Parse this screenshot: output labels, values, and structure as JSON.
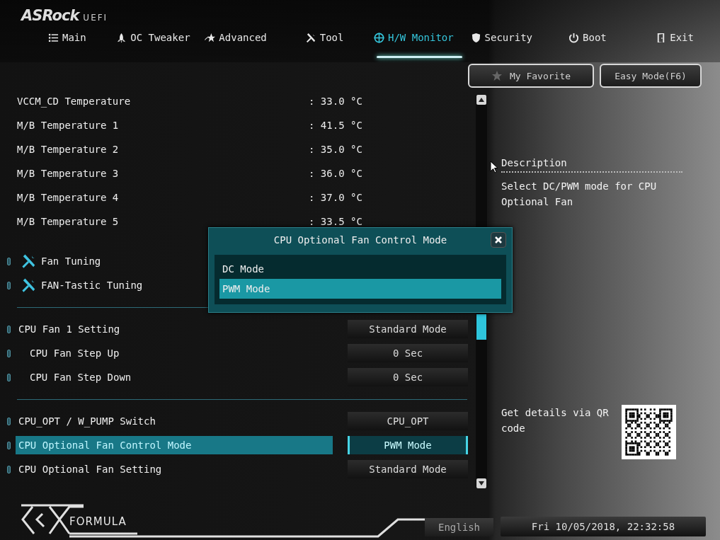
{
  "logo": {
    "brand": "ASRock",
    "suffix": "UEFI"
  },
  "tabs": [
    {
      "label": "Main",
      "kind": "list",
      "selected": false
    },
    {
      "label": "OC Tweaker",
      "kind": "rocket",
      "selected": false
    },
    {
      "label": "Advanced",
      "kind": "star",
      "selected": false
    },
    {
      "label": "Tool",
      "kind": "tools",
      "selected": false
    },
    {
      "label": "H/W Monitor",
      "kind": "crosshair",
      "selected": true
    },
    {
      "label": "Security",
      "kind": "shield",
      "selected": false
    },
    {
      "label": "Boot",
      "kind": "power",
      "selected": false
    },
    {
      "label": "Exit",
      "kind": "door",
      "selected": false
    }
  ],
  "toolbar": {
    "favorite": "My Favorite",
    "easy_mode": "Easy Mode(F6)"
  },
  "items": [
    {
      "kind": "reading",
      "label": "VCCM_CD Temperature",
      "value": ": 33.0 °C"
    },
    {
      "kind": "reading",
      "label": "M/B Temperature 1",
      "value": ": 41.5 °C"
    },
    {
      "kind": "reading",
      "label": "M/B Temperature 2",
      "value": ": 35.0 °C"
    },
    {
      "kind": "reading",
      "label": "M/B Temperature 3",
      "value": ": 36.0 °C"
    },
    {
      "kind": "reading",
      "label": "M/B Temperature 4",
      "value": ": 37.0 °C"
    },
    {
      "kind": "reading",
      "label": "M/B Temperature 5",
      "value": ": 33.5 °C"
    },
    {
      "kind": "submenu",
      "label": "Fan Tuning"
    },
    {
      "kind": "submenu",
      "label": "FAN-Tastic Tuning"
    },
    {
      "kind": "divider"
    },
    {
      "kind": "setting",
      "label": "CPU Fan 1 Setting",
      "value": "Standard Mode",
      "selected": false,
      "children": [
        {
          "kind": "setting",
          "label": "CPU Fan Step Up",
          "value": "0 Sec",
          "selected": false
        },
        {
          "kind": "setting",
          "label": "CPU Fan Step Down",
          "value": "0 Sec",
          "selected": false
        }
      ]
    },
    {
      "kind": "divider"
    },
    {
      "kind": "setting",
      "label": "CPU_OPT / W_PUMP Switch",
      "value": "CPU_OPT",
      "selected": false
    },
    {
      "kind": "setting",
      "label": "CPU Optional Fan Control Mode",
      "value": "PWM Mode",
      "selected": true
    },
    {
      "kind": "setting",
      "label": "CPU Optional Fan Setting",
      "value": "Standard Mode",
      "selected": false
    }
  ],
  "description": {
    "title": "Description",
    "text": "Select DC/PWM mode for CPU Optional Fan"
  },
  "qr": {
    "text": "Get details via QR code"
  },
  "popup": {
    "title": "CPU Optional Fan Control Mode",
    "options": [
      {
        "label": "DC Mode",
        "selected": false
      },
      {
        "label": "PWM Mode",
        "selected": true
      }
    ]
  },
  "footer": {
    "logo_text": "FORMULA",
    "language": "English",
    "datetime": "Fri 10/05/2018, 22:32:58"
  }
}
